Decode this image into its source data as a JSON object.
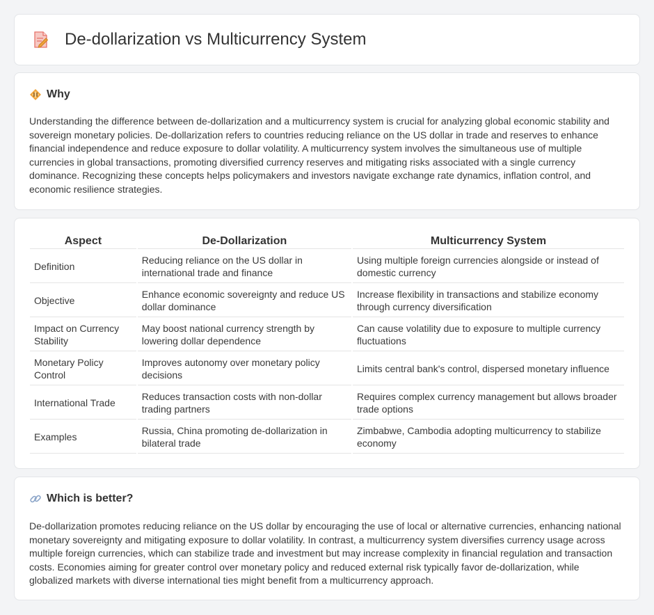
{
  "header": {
    "title": "De-dollarization vs Multicurrency System",
    "icon": "document-pencil-icon"
  },
  "why": {
    "icon": "diamond-warning-icon",
    "title": "Why",
    "text": "Understanding the difference between de-dollarization and a multicurrency system is crucial for analyzing global economic stability and sovereign monetary policies. De-dollarization refers to countries reducing reliance on the US dollar in trade and reserves to enhance financial independence and reduce exposure to dollar volatility. A multicurrency system involves the simultaneous use of multiple currencies in global transactions, promoting diversified currency reserves and mitigating risks associated with a single currency dominance. Recognizing these concepts helps policymakers and investors navigate exchange rate dynamics, inflation control, and economic resilience strategies."
  },
  "table": {
    "headers": [
      "Aspect",
      "De-Dollarization",
      "Multicurrency System"
    ],
    "rows": [
      [
        "Definition",
        "Reducing reliance on the US dollar in international trade and finance",
        "Using multiple foreign currencies alongside or instead of domestic currency"
      ],
      [
        "Objective",
        "Enhance economic sovereignty and reduce US dollar dominance",
        "Increase flexibility in transactions and stabilize economy through currency diversification"
      ],
      [
        "Impact on Currency Stability",
        "May boost national currency strength by lowering dollar dependence",
        "Can cause volatility due to exposure to multiple currency fluctuations"
      ],
      [
        "Monetary Policy Control",
        "Improves autonomy over monetary policy decisions",
        "Limits central bank's control, dispersed monetary influence"
      ],
      [
        "International Trade",
        "Reduces transaction costs with non-dollar trading partners",
        "Requires complex currency management but allows broader trade options"
      ],
      [
        "Examples",
        "Russia, China promoting de-dollarization in bilateral trade",
        "Zimbabwe, Cambodia adopting multicurrency to stabilize economy"
      ]
    ]
  },
  "better": {
    "icon": "link-icon",
    "title": "Which is better?",
    "text": "De-dollarization promotes reducing reliance on the US dollar by encouraging the use of local or alternative currencies, enhancing national monetary sovereignty and mitigating exposure to dollar volatility. In contrast, a multicurrency system diversifies currency usage across multiple foreign currencies, which can stabilize trade and investment but may increase complexity in financial regulation and transaction costs. Economies aiming for greater control over monetary policy and reduced external risk typically favor de-dollarization, while globalized markets with diverse international ties might benefit from a multicurrency approach."
  },
  "colors": {
    "accent_orange": "#f0a33a",
    "icon_pink": "#e8736b",
    "link_blue": "#8aa4c8"
  }
}
